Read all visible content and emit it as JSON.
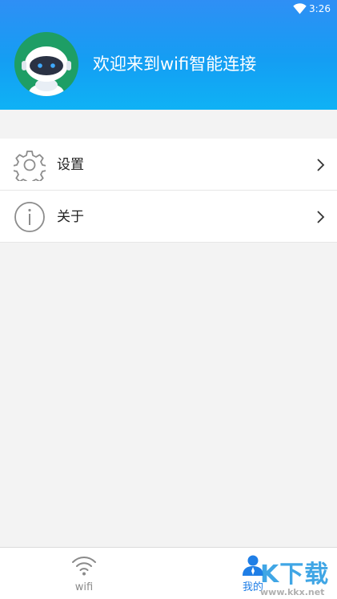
{
  "status_bar": {
    "time": "3:26",
    "icons": [
      "wifi-signal-icon"
    ]
  },
  "header": {
    "welcome_text": "欢迎来到wifi智能连接",
    "avatar_icon": "robot-avatar-icon"
  },
  "menu": {
    "items": [
      {
        "label": "设置",
        "icon": "gear-icon"
      },
      {
        "label": "关于",
        "icon": "info-icon"
      }
    ]
  },
  "tabs": [
    {
      "label": "wifi",
      "icon": "wifi-icon",
      "active": false
    },
    {
      "label": "我的",
      "icon": "person-icon",
      "active": true
    }
  ],
  "watermark": {
    "text": "K下载",
    "url": "www.kkx.net"
  },
  "colors": {
    "header_blue": "#1a9af3",
    "active_tab": "#1f7ee6",
    "inactive_tab": "#8a8a8a",
    "avatar_green": "#1e9e65"
  }
}
